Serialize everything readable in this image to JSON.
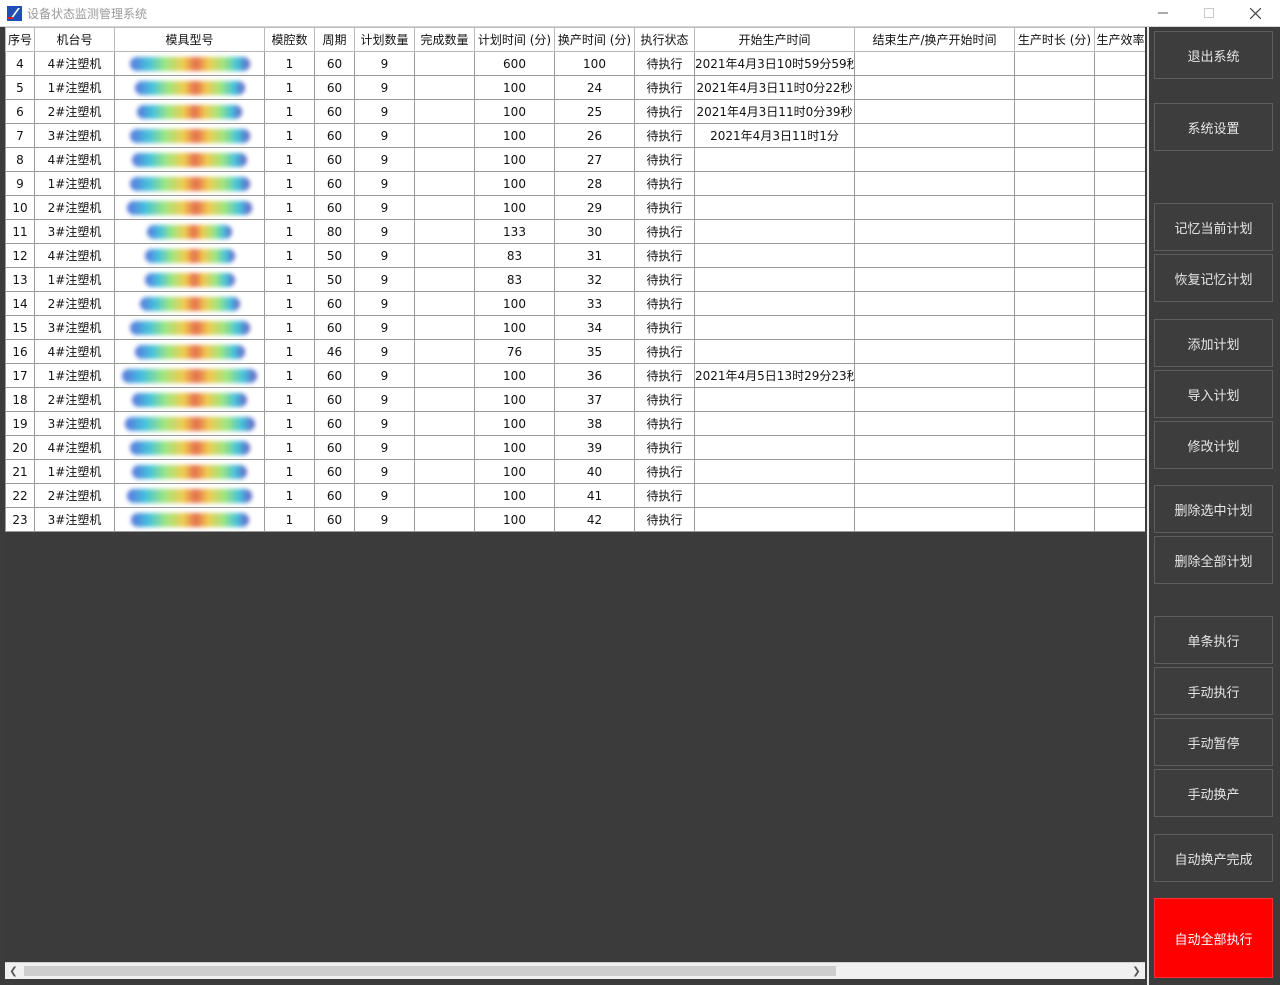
{
  "window": {
    "title": "设备状态监测管理系统",
    "controls": [
      "minimize-icon",
      "maximize-icon",
      "close-icon"
    ]
  },
  "table": {
    "columns": [
      "序号",
      "机台号",
      "模具型号",
      "模腔数",
      "周期",
      "计划数量",
      "完成数量",
      "计划时间 (分)",
      "换产时间 (分)",
      "执行状态",
      "开始生产时间",
      "结束生产/换产开始时间",
      "生产时长 (分)",
      "生产效率"
    ],
    "rows": [
      [
        "4",
        "4#注塑机",
        "",
        "1",
        "60",
        "9",
        "",
        "600",
        "100",
        "待执行",
        "2021年4月3日10时59分59秒",
        "",
        "",
        ""
      ],
      [
        "5",
        "1#注塑机",
        "",
        "1",
        "60",
        "9",
        "",
        "100",
        "24",
        "待执行",
        "2021年4月3日11时0分22秒",
        "",
        "",
        ""
      ],
      [
        "6",
        "2#注塑机",
        "",
        "1",
        "60",
        "9",
        "",
        "100",
        "25",
        "待执行",
        "2021年4月3日11时0分39秒",
        "",
        "",
        ""
      ],
      [
        "7",
        "3#注塑机",
        "",
        "1",
        "60",
        "9",
        "",
        "100",
        "26",
        "待执行",
        "2021年4月3日11时1分",
        "",
        "",
        ""
      ],
      [
        "8",
        "4#注塑机",
        "",
        "1",
        "60",
        "9",
        "",
        "100",
        "27",
        "待执行",
        "",
        "",
        "",
        ""
      ],
      [
        "9",
        "1#注塑机",
        "",
        "1",
        "60",
        "9",
        "",
        "100",
        "28",
        "待执行",
        "",
        "",
        "",
        ""
      ],
      [
        "10",
        "2#注塑机",
        "",
        "1",
        "60",
        "9",
        "",
        "100",
        "29",
        "待执行",
        "",
        "",
        "",
        ""
      ],
      [
        "11",
        "3#注塑机",
        "",
        "1",
        "80",
        "9",
        "",
        "133",
        "30",
        "待执行",
        "",
        "",
        "",
        ""
      ],
      [
        "12",
        "4#注塑机",
        "",
        "1",
        "50",
        "9",
        "",
        "83",
        "31",
        "待执行",
        "",
        "",
        "",
        ""
      ],
      [
        "13",
        "1#注塑机",
        "",
        "1",
        "50",
        "9",
        "",
        "83",
        "32",
        "待执行",
        "",
        "",
        "",
        ""
      ],
      [
        "14",
        "2#注塑机",
        "",
        "1",
        "60",
        "9",
        "",
        "100",
        "33",
        "待执行",
        "",
        "",
        "",
        ""
      ],
      [
        "15",
        "3#注塑机",
        "",
        "1",
        "60",
        "9",
        "",
        "100",
        "34",
        "待执行",
        "",
        "",
        "",
        ""
      ],
      [
        "16",
        "4#注塑机",
        "",
        "1",
        "46",
        "9",
        "",
        "76",
        "35",
        "待执行",
        "",
        "",
        "",
        ""
      ],
      [
        "17",
        "1#注塑机",
        "",
        "1",
        "60",
        "9",
        "",
        "100",
        "36",
        "待执行",
        "2021年4月5日13时29分23秒",
        "",
        "",
        ""
      ],
      [
        "18",
        "2#注塑机",
        "",
        "1",
        "60",
        "9",
        "",
        "100",
        "37",
        "待执行",
        "",
        "",
        "",
        ""
      ],
      [
        "19",
        "3#注塑机",
        "",
        "1",
        "60",
        "9",
        "",
        "100",
        "38",
        "待执行",
        "",
        "",
        "",
        ""
      ],
      [
        "20",
        "4#注塑机",
        "",
        "1",
        "60",
        "9",
        "",
        "100",
        "39",
        "待执行",
        "",
        "",
        "",
        ""
      ],
      [
        "21",
        "1#注塑机",
        "",
        "1",
        "60",
        "9",
        "",
        "100",
        "40",
        "待执行",
        "",
        "",
        "",
        ""
      ],
      [
        "22",
        "2#注塑机",
        "",
        "1",
        "60",
        "9",
        "",
        "100",
        "41",
        "待执行",
        "",
        "",
        "",
        ""
      ],
      [
        "23",
        "3#注塑机",
        "",
        "1",
        "60",
        "9",
        "",
        "100",
        "42",
        "待执行",
        "",
        "",
        "",
        ""
      ]
    ]
  },
  "sidebar": {
    "buttons": [
      {
        "label": "退出系统",
        "name": "exit-system-button"
      },
      {
        "label": "系统设置",
        "name": "system-settings-button"
      },
      {
        "label": "记忆当前计划",
        "name": "save-current-plan-button"
      },
      {
        "label": "恢复记忆计划",
        "name": "restore-saved-plan-button"
      },
      {
        "label": "添加计划",
        "name": "add-plan-button"
      },
      {
        "label": "导入计划",
        "name": "import-plan-button"
      },
      {
        "label": "修改计划",
        "name": "edit-plan-button"
      },
      {
        "label": "删除选中计划",
        "name": "delete-selected-plan-button"
      },
      {
        "label": "删除全部计划",
        "name": "delete-all-plans-button"
      },
      {
        "label": "单条执行",
        "name": "execute-single-button"
      },
      {
        "label": "手动执行",
        "name": "manual-execute-button"
      },
      {
        "label": "手动暂停",
        "name": "manual-pause-button"
      },
      {
        "label": "手动换产",
        "name": "manual-changeover-button"
      },
      {
        "label": "自动换产完成",
        "name": "auto-changeover-complete-button"
      },
      {
        "label": "自动全部执行",
        "name": "auto-execute-all-button",
        "accent": "#ff0000"
      }
    ]
  },
  "colors": {
    "background": "#3c3c3c",
    "accent": "#ff0000"
  }
}
